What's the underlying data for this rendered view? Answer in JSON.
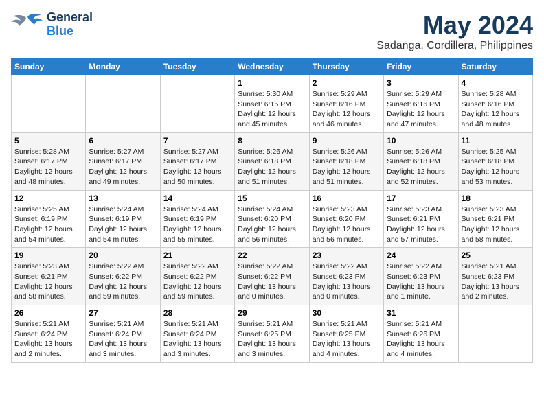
{
  "header": {
    "logo_general": "General",
    "logo_blue": "Blue",
    "main_title": "May 2024",
    "subtitle": "Sadanga, Cordillera, Philippines"
  },
  "days_of_week": [
    "Sunday",
    "Monday",
    "Tuesday",
    "Wednesday",
    "Thursday",
    "Friday",
    "Saturday"
  ],
  "weeks": [
    [
      {
        "day": "",
        "info": ""
      },
      {
        "day": "",
        "info": ""
      },
      {
        "day": "",
        "info": ""
      },
      {
        "day": "1",
        "info": "Sunrise: 5:30 AM\nSunset: 6:15 PM\nDaylight: 12 hours\nand 45 minutes."
      },
      {
        "day": "2",
        "info": "Sunrise: 5:29 AM\nSunset: 6:16 PM\nDaylight: 12 hours\nand 46 minutes."
      },
      {
        "day": "3",
        "info": "Sunrise: 5:29 AM\nSunset: 6:16 PM\nDaylight: 12 hours\nand 47 minutes."
      },
      {
        "day": "4",
        "info": "Sunrise: 5:28 AM\nSunset: 6:16 PM\nDaylight: 12 hours\nand 48 minutes."
      }
    ],
    [
      {
        "day": "5",
        "info": "Sunrise: 5:28 AM\nSunset: 6:17 PM\nDaylight: 12 hours\nand 48 minutes."
      },
      {
        "day": "6",
        "info": "Sunrise: 5:27 AM\nSunset: 6:17 PM\nDaylight: 12 hours\nand 49 minutes."
      },
      {
        "day": "7",
        "info": "Sunrise: 5:27 AM\nSunset: 6:17 PM\nDaylight: 12 hours\nand 50 minutes."
      },
      {
        "day": "8",
        "info": "Sunrise: 5:26 AM\nSunset: 6:18 PM\nDaylight: 12 hours\nand 51 minutes."
      },
      {
        "day": "9",
        "info": "Sunrise: 5:26 AM\nSunset: 6:18 PM\nDaylight: 12 hours\nand 51 minutes."
      },
      {
        "day": "10",
        "info": "Sunrise: 5:26 AM\nSunset: 6:18 PM\nDaylight: 12 hours\nand 52 minutes."
      },
      {
        "day": "11",
        "info": "Sunrise: 5:25 AM\nSunset: 6:18 PM\nDaylight: 12 hours\nand 53 minutes."
      }
    ],
    [
      {
        "day": "12",
        "info": "Sunrise: 5:25 AM\nSunset: 6:19 PM\nDaylight: 12 hours\nand 54 minutes."
      },
      {
        "day": "13",
        "info": "Sunrise: 5:24 AM\nSunset: 6:19 PM\nDaylight: 12 hours\nand 54 minutes."
      },
      {
        "day": "14",
        "info": "Sunrise: 5:24 AM\nSunset: 6:19 PM\nDaylight: 12 hours\nand 55 minutes."
      },
      {
        "day": "15",
        "info": "Sunrise: 5:24 AM\nSunset: 6:20 PM\nDaylight: 12 hours\nand 56 minutes."
      },
      {
        "day": "16",
        "info": "Sunrise: 5:23 AM\nSunset: 6:20 PM\nDaylight: 12 hours\nand 56 minutes."
      },
      {
        "day": "17",
        "info": "Sunrise: 5:23 AM\nSunset: 6:21 PM\nDaylight: 12 hours\nand 57 minutes."
      },
      {
        "day": "18",
        "info": "Sunrise: 5:23 AM\nSunset: 6:21 PM\nDaylight: 12 hours\nand 58 minutes."
      }
    ],
    [
      {
        "day": "19",
        "info": "Sunrise: 5:23 AM\nSunset: 6:21 PM\nDaylight: 12 hours\nand 58 minutes."
      },
      {
        "day": "20",
        "info": "Sunrise: 5:22 AM\nSunset: 6:22 PM\nDaylight: 12 hours\nand 59 minutes."
      },
      {
        "day": "21",
        "info": "Sunrise: 5:22 AM\nSunset: 6:22 PM\nDaylight: 12 hours\nand 59 minutes."
      },
      {
        "day": "22",
        "info": "Sunrise: 5:22 AM\nSunset: 6:22 PM\nDaylight: 13 hours\nand 0 minutes."
      },
      {
        "day": "23",
        "info": "Sunrise: 5:22 AM\nSunset: 6:23 PM\nDaylight: 13 hours\nand 0 minutes."
      },
      {
        "day": "24",
        "info": "Sunrise: 5:22 AM\nSunset: 6:23 PM\nDaylight: 13 hours\nand 1 minute."
      },
      {
        "day": "25",
        "info": "Sunrise: 5:21 AM\nSunset: 6:23 PM\nDaylight: 13 hours\nand 2 minutes."
      }
    ],
    [
      {
        "day": "26",
        "info": "Sunrise: 5:21 AM\nSunset: 6:24 PM\nDaylight: 13 hours\nand 2 minutes."
      },
      {
        "day": "27",
        "info": "Sunrise: 5:21 AM\nSunset: 6:24 PM\nDaylight: 13 hours\nand 3 minutes."
      },
      {
        "day": "28",
        "info": "Sunrise: 5:21 AM\nSunset: 6:24 PM\nDaylight: 13 hours\nand 3 minutes."
      },
      {
        "day": "29",
        "info": "Sunrise: 5:21 AM\nSunset: 6:25 PM\nDaylight: 13 hours\nand 3 minutes."
      },
      {
        "day": "30",
        "info": "Sunrise: 5:21 AM\nSunset: 6:25 PM\nDaylight: 13 hours\nand 4 minutes."
      },
      {
        "day": "31",
        "info": "Sunrise: 5:21 AM\nSunset: 6:26 PM\nDaylight: 13 hours\nand 4 minutes."
      },
      {
        "day": "",
        "info": ""
      }
    ]
  ]
}
